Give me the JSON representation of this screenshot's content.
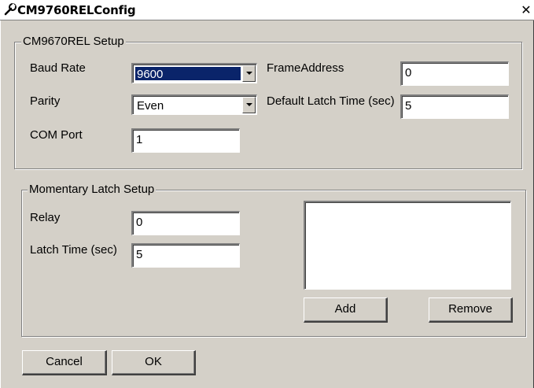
{
  "window": {
    "title": "CM9760RELConfig",
    "close_glyph": "✕"
  },
  "setup": {
    "legend": "CM9670REL Setup",
    "baud_rate": {
      "label": "Baud Rate",
      "value": "9600"
    },
    "parity": {
      "label": "Parity",
      "value": "Even"
    },
    "com_port": {
      "label": "COM Port",
      "value": "1"
    },
    "frame_address": {
      "label": "FrameAddress",
      "value": "0"
    },
    "default_latch_time": {
      "label": "Default Latch Time (sec)",
      "value": "5"
    }
  },
  "momentary": {
    "legend": "Momentary Latch Setup",
    "relay": {
      "label": "Relay",
      "value": "0"
    },
    "latch_time": {
      "label": "Latch Time (sec)",
      "value": "5"
    },
    "add_label": "Add",
    "remove_label": "Remove"
  },
  "footer": {
    "cancel_label": "Cancel",
    "ok_label": "OK"
  },
  "colors": {
    "dialog_bg": "#d4d0c8",
    "selection_bg": "#0a246a"
  },
  "icons": {
    "app": "wrench-icon",
    "close": "close-icon",
    "dropdown": "chevron-down-icon"
  }
}
